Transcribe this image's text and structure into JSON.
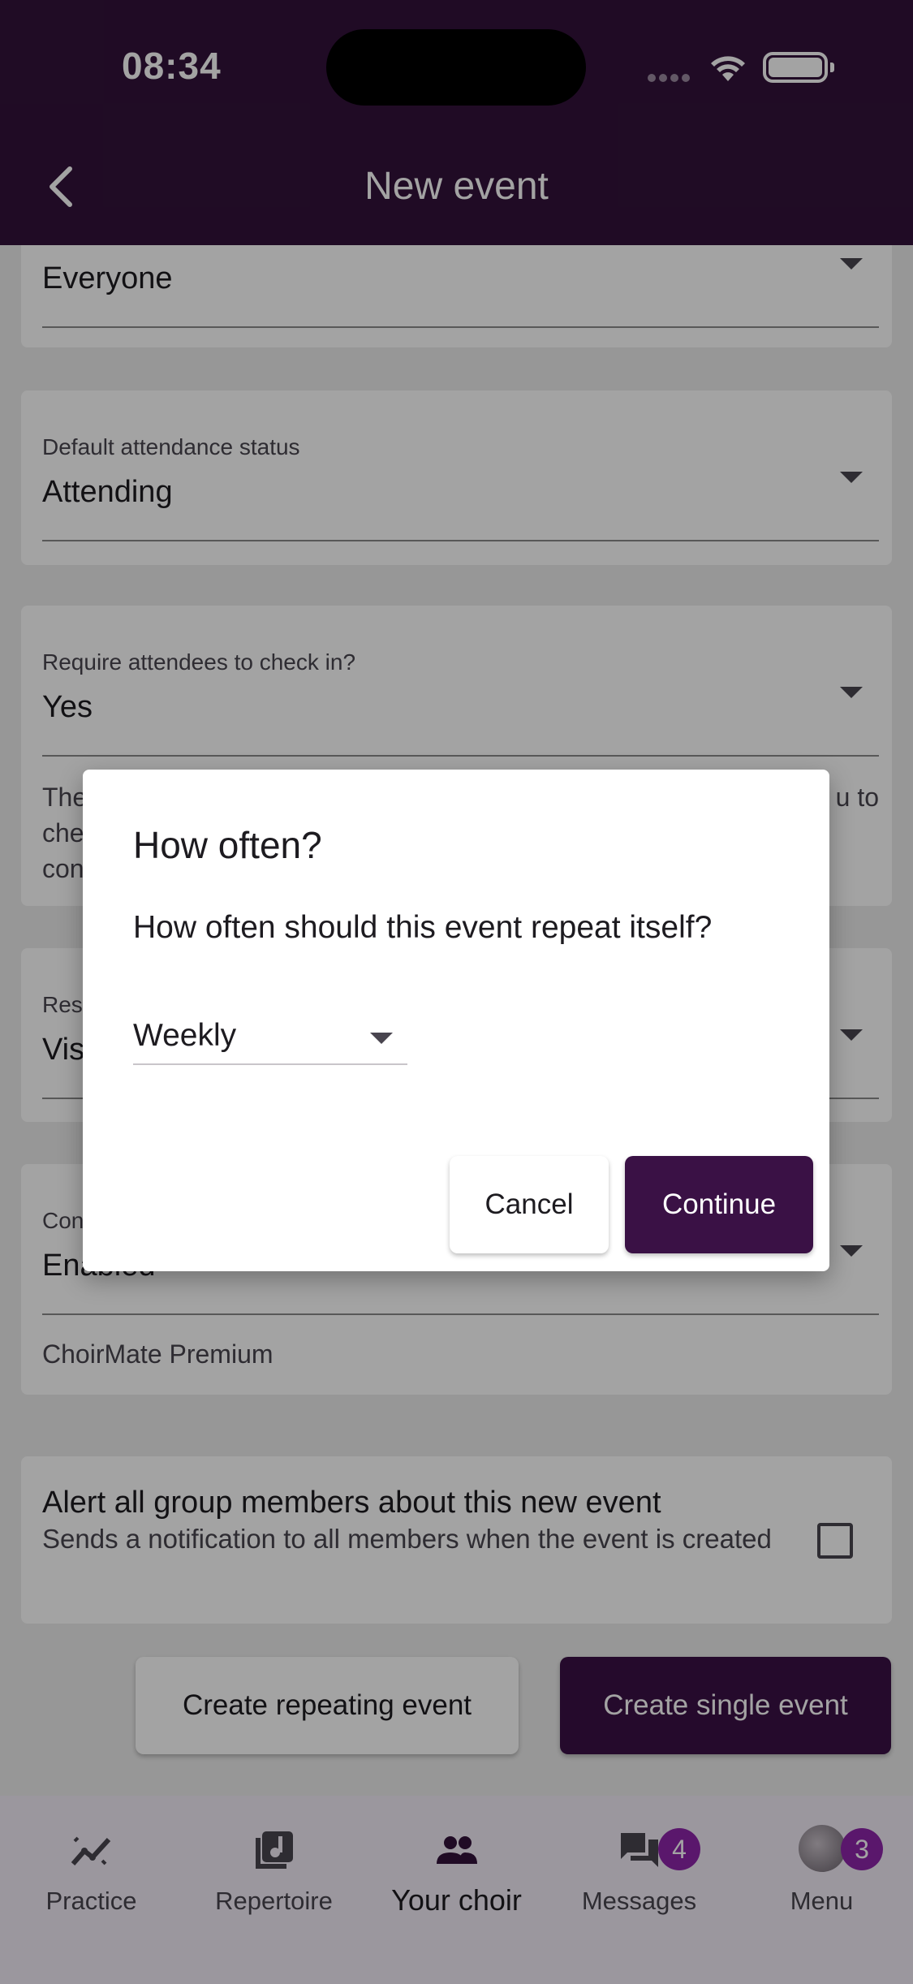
{
  "status_bar": {
    "time": "08:34"
  },
  "header": {
    "title": "New event"
  },
  "form": {
    "audience": {
      "value": "Everyone"
    },
    "attendance": {
      "label": "Default attendance status",
      "value": "Attending"
    },
    "checkin": {
      "label": "Require attendees to check in?",
      "value": "Yes",
      "helper_visible": [
        "The",
        "che",
        "con"
      ],
      "helper_right": "u to"
    },
    "responses": {
      "label_partial": "Res",
      "value_partial": "Vis"
    },
    "comments": {
      "label_partial": "Con",
      "value": "Enabled",
      "helper": "ChoirMate Premium"
    },
    "alert": {
      "title": "Alert all group members about this new event",
      "subtitle": "Sends a notification to all members when the event is created",
      "checked": false
    }
  },
  "actions": {
    "repeating_label": "Create repeating event",
    "single_label": "Create single event"
  },
  "bottom_nav": {
    "items": [
      {
        "label": "Practice",
        "icon": "trending-chart-icon"
      },
      {
        "label": "Repertoire",
        "icon": "music-library-icon"
      },
      {
        "label": "Your choir",
        "icon": "group-people-icon"
      },
      {
        "label": "Messages",
        "icon": "chat-bubbles-icon",
        "badge": "4"
      },
      {
        "label": "Menu",
        "icon": "avatar",
        "badge": "3"
      }
    ],
    "active": "Your choir"
  },
  "dialog": {
    "title": "How often?",
    "body": "How often should this event repeat itself?",
    "select_value": "Weekly",
    "cancel_label": "Cancel",
    "continue_label": "Continue"
  },
  "colors": {
    "header_bg": "#32123a",
    "primary": "#3a1145",
    "badge": "#8e24aa",
    "nav_bg": "#f3edf7"
  }
}
